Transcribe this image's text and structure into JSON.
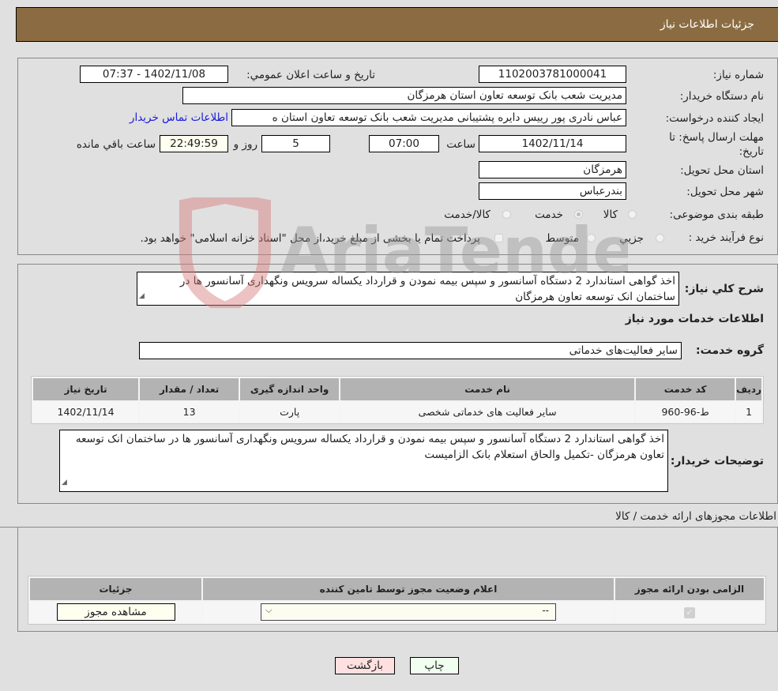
{
  "header": {
    "title": "جزئیات اطلاعات نیاز"
  },
  "form": {
    "need_number": {
      "label": "شماره نیاز:",
      "value": "1102003781000041"
    },
    "announce_datetime": {
      "label": "تاریخ و ساعت اعلان عمومي:",
      "value": "1402/11/08 - 07:37"
    },
    "buyer_org": {
      "label": "نام دستگاه خريدار:",
      "value": "مدیریت شعب بانک توسعه تعاون استان هرمزگان"
    },
    "requester": {
      "label": "ايجاد کننده درخواست:",
      "value": "عباس نادری پور رییس دایره پشتیبانی مدیریت شعب بانک توسعه تعاون استان ه",
      "contact_link": "اطلاعات تماس خريدار"
    },
    "deadline": {
      "label": "مهلت ارسال پاسخ: تا تاريخ:",
      "date": "1402/11/14",
      "time_label": "ساعت",
      "time": "07:00",
      "days": "5",
      "days_label": "روز و",
      "remaining": "22:49:59",
      "remaining_label": "ساعت باقي مانده"
    },
    "delivery_province": {
      "label": "استان محل تحويل:",
      "value": "هرمزگان"
    },
    "delivery_city": {
      "label": "شهر محل تحويل:",
      "value": "بندرعباس"
    },
    "category": {
      "label": "طبقه بندی موضوعی:",
      "options": [
        "کالا",
        "خدمت",
        "کالا/خدمت"
      ],
      "selected": "خدمت"
    },
    "purchase_process": {
      "label": "نوع فرآیند خرید :",
      "options": [
        "جزيي",
        "متوسط"
      ],
      "treasury_note": "پرداخت تمام يا بخشی از مبلغ خريد،از محل \"اسناد خزانه اسلامی\" خواهد بود."
    }
  },
  "description": {
    "label": "شرح کلي نياز:",
    "value": "اخذ گواهی استاندارد 2 دستگاه آسانسور و سپس بیمه نمودن و قرارداد یکساله سرویس ونگهداری آسانسور ها در ساختمان انک توسعه تعاون هرمزگان"
  },
  "services": {
    "title": "اطلاعات خدمات مورد نياز",
    "group_label": "گروه خدمت:",
    "group_value": "سایر فعالیت‌های خدماتی",
    "columns": [
      "رديف",
      "کد خدمت",
      "نام خدمت",
      "واحد اندازه گيری",
      "تعداد / مقدار",
      "تاريخ نياز"
    ],
    "rows": [
      [
        "1",
        "ط-96-960",
        "سایر فعالیت های خدماتی شخصی",
        "پارت",
        "13",
        "1402/11/14"
      ]
    ]
  },
  "buyer_notes": {
    "label": "توضيحات خريدار:",
    "value": "اخذ گواهی استاندارد 2 دستگاه آسانسور و سپس بیمه نمودن و قرارداد یکساله سرویس ونگهداری آسانسور ها در ساختمان انک توسعه تعاون هرمزگان -تکمیل والحاق استعلام بانک الزامیست"
  },
  "permits": {
    "title": "اطلاعات مجوزهای ارائه خدمت / کالا",
    "columns": [
      "الزامی بودن ارائه مجوز",
      "اعلام وضعیت مجوز توسط تامین کننده",
      "جزئیات"
    ],
    "row": {
      "required": true,
      "status_selected": "--",
      "details_button": "مشاهده مجوز"
    }
  },
  "footer": {
    "print_button": "چاپ",
    "back_button": "بازگشت"
  },
  "watermark": {
    "text": "AriaTender.neT"
  },
  "colors": {
    "header_bg": "#8b6c42",
    "link": "#1a1adb",
    "print_bg": "#f0fff0",
    "back_bg": "#ffe0e0"
  }
}
